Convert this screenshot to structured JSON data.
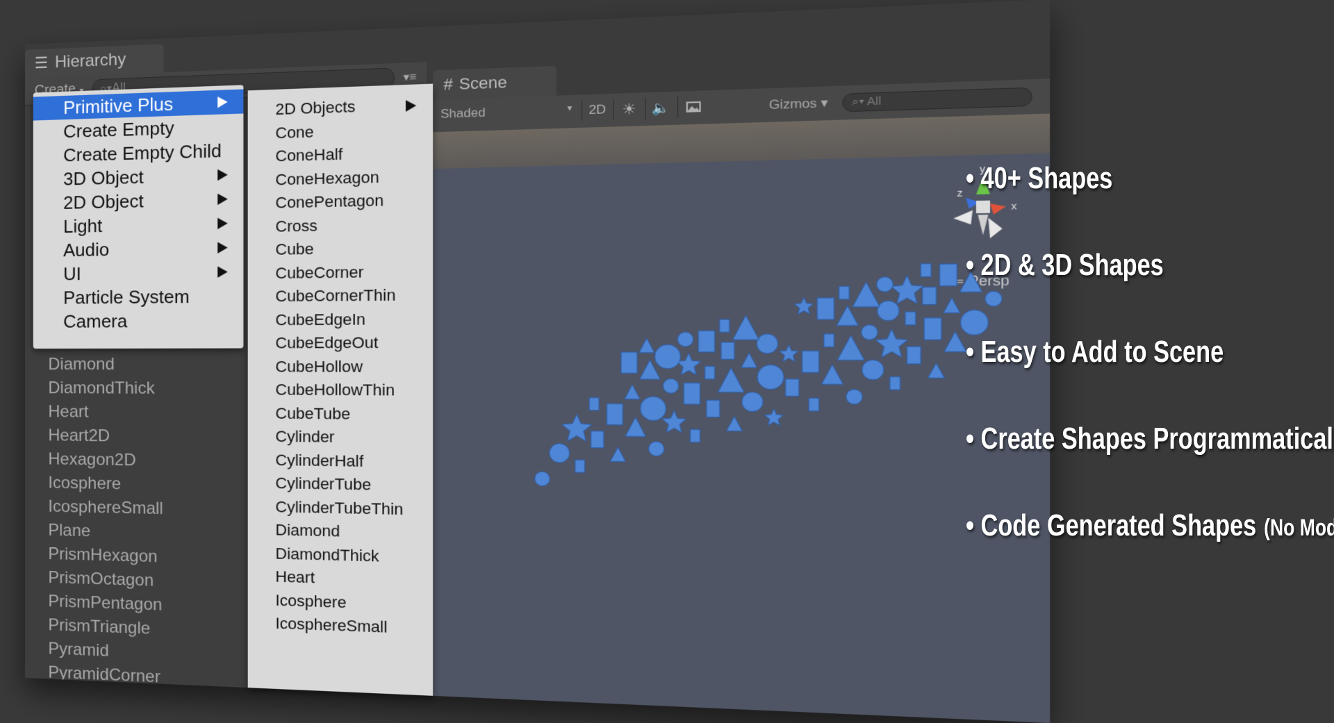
{
  "hierarchy": {
    "tab_label": "Hierarchy",
    "create_label": "Create",
    "search_placeholder": "All",
    "items": [
      "Diamond",
      "DiamondThick",
      "Heart",
      "Heart2D",
      "Hexagon2D",
      "Icosphere",
      "IcosphereSmall",
      "Plane",
      "PrismHexagon",
      "PrismOctagon",
      "PrismPentagon",
      "PrismTriangle",
      "Pyramid",
      "PyramidCorner"
    ]
  },
  "create_menu": {
    "items": [
      {
        "label": "Primitive Plus",
        "submenu": true,
        "selected": true
      },
      {
        "label": "Create Empty",
        "submenu": false
      },
      {
        "label": "Create Empty Child",
        "submenu": false
      },
      {
        "label": "3D Object",
        "submenu": true
      },
      {
        "label": "2D Object",
        "submenu": true
      },
      {
        "label": "Light",
        "submenu": true
      },
      {
        "label": "Audio",
        "submenu": true
      },
      {
        "label": "UI",
        "submenu": true
      },
      {
        "label": "Particle System",
        "submenu": false
      },
      {
        "label": "Camera",
        "submenu": false
      }
    ]
  },
  "primitive_plus_menu": {
    "items": [
      {
        "label": "2D Objects",
        "submenu": true
      },
      {
        "label": "Cone"
      },
      {
        "label": "ConeHalf"
      },
      {
        "label": "ConeHexagon"
      },
      {
        "label": "ConePentagon"
      },
      {
        "label": "Cross"
      },
      {
        "label": "Cube"
      },
      {
        "label": "CubeCorner"
      },
      {
        "label": "CubeCornerThin"
      },
      {
        "label": "CubeEdgeIn"
      },
      {
        "label": "CubeEdgeOut"
      },
      {
        "label": "CubeHollow"
      },
      {
        "label": "CubeHollowThin"
      },
      {
        "label": "CubeTube"
      },
      {
        "label": "Cylinder"
      },
      {
        "label": "CylinderHalf"
      },
      {
        "label": "CylinderTube"
      },
      {
        "label": "CylinderTubeThin"
      },
      {
        "label": "Diamond"
      },
      {
        "label": "DiamondThick"
      },
      {
        "label": "Heart"
      },
      {
        "label": "Icosphere"
      },
      {
        "label": "IcosphereSmall"
      }
    ]
  },
  "scene": {
    "tab_label": "Scene",
    "shading_mode": "Shaded",
    "mode_2d_label": "2D",
    "gizmos_label": "Gizmos",
    "search_placeholder": "All",
    "persp_label": "Persp",
    "axis_labels": {
      "x": "x",
      "y": "y",
      "z": "z"
    },
    "shape_color": "#4f86d6"
  },
  "features": [
    {
      "text": "• 40+ Shapes"
    },
    {
      "text": "• 2D & 3D Shapes"
    },
    {
      "text": "• Easy to Add to Scene"
    },
    {
      "text": "• Create Shapes Programmatically"
    },
    {
      "text": "• Code Generated Shapes",
      "note": "(No Models)"
    }
  ]
}
